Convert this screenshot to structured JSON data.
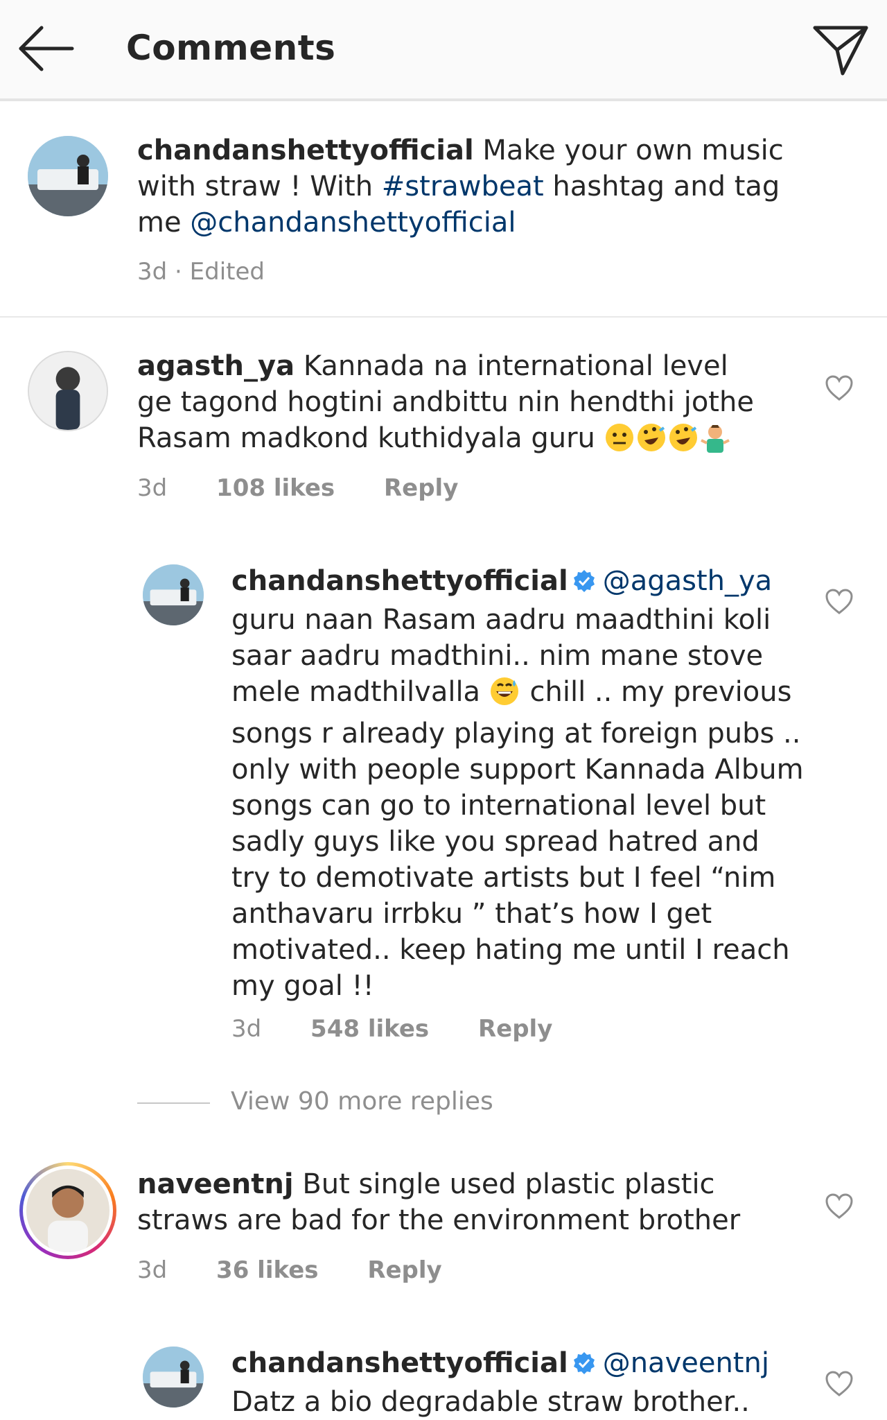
{
  "header": {
    "title": "Comments",
    "back_icon": "arrow-left-icon",
    "share_icon": "paper-plane-icon"
  },
  "caption": {
    "username": "chandanshettyofficial",
    "text_1": "Make your own music with straw ! With",
    "hashtag": "#strawbeat",
    "text_2": "hashtag and tag me",
    "mention": "@chandanshettyofficial",
    "time": "3d · Edited"
  },
  "comments": [
    {
      "username": "agasth_ya",
      "text": "Kannada na international level ge tagond hogtini andbittu nin hendthi jothe Rasam madkond kuthidyala guru",
      "emojis": [
        "neutral-face",
        "rofl",
        "rofl",
        "man-shrugging"
      ],
      "time": "3d",
      "likes": "108 likes",
      "reply": "Reply"
    },
    {
      "username": "chandanshettyofficial",
      "mention": "@agasth_ya",
      "text_1": "guru naan Rasam aadru maadthini koli saar aadru madthini.. nim mane stove mele madthilvalla",
      "text_2": "chill .. my previous songs r already playing at foreign pubs .. only with people support Kannada Album songs can go to international level but sadly guys like you spread hatred and try to demotivate artists but I feel “nim anthavaru irrbku ” that’s how I get motivated.. keep hating me until I reach my goal !!",
      "time": "3d",
      "likes": "548 likes",
      "reply": "Reply"
    },
    {
      "username": "naveentnj",
      "text": "But single used plastic plastic straws are bad for the environment brother",
      "time": "3d",
      "likes": "36 likes",
      "reply": "Reply"
    },
    {
      "username": "chandanshettyofficial",
      "mention": "@naveentnj",
      "text": "Datz a bio degradable straw brother.."
    }
  ],
  "view_more": "View 90 more replies",
  "colors": {
    "link": "#00376b",
    "muted": "#8e8e8e",
    "verified": "#3897f0",
    "story_ring": "#d6249f"
  }
}
